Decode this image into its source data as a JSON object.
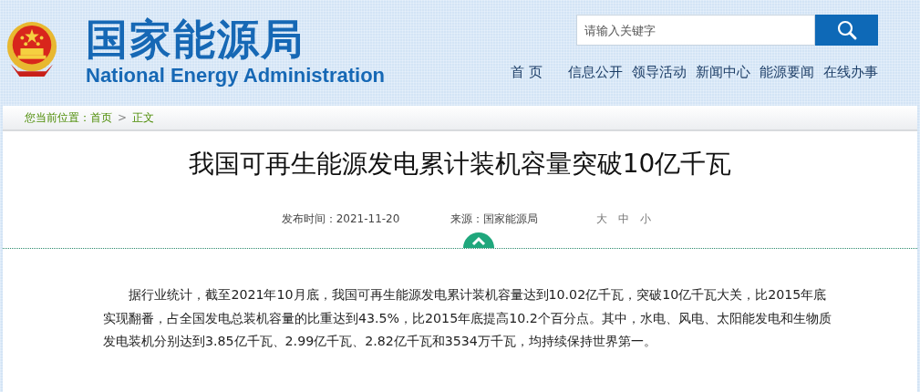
{
  "header": {
    "title": "国家能源局",
    "subtitle": "National Energy Administration"
  },
  "search": {
    "placeholder": "请输入关键字"
  },
  "nav": [
    {
      "label": "首 页",
      "selected": false
    },
    {
      "label": "信息公开",
      "selected": false
    },
    {
      "label": "领导活动",
      "selected": false
    },
    {
      "label": "新闻中心",
      "selected": false
    },
    {
      "label": "能源要闻",
      "selected": false
    },
    {
      "label": "在线办事",
      "selected": false
    }
  ],
  "breadcrumb": {
    "label": "您当前位置：",
    "items": [
      "首页",
      "正文"
    ],
    "separator": ">"
  },
  "article": {
    "title": "我国可再生能源发电累计装机容量突破10亿千瓦",
    "published": "发布时间：2021-11-20",
    "source": "来源：国家能源局",
    "font_sizes": [
      "大",
      "中",
      "小"
    ],
    "paragraphs": [
      "据行业统计，截至2021年10月底，我国可再生能源发电累计装机容量达到10.02亿千瓦，突破10亿千瓦大关，比2015年底实现翻番，占全国发电总装机容量的比重达到43.5%，比2015年底提高10.2个百分点。其中，水电、风电、太阳能发电和生物质发电装机分别达到3.85亿千瓦、2.99亿千瓦、2.82亿千瓦和3534万千瓦，均持续保持世界第一。"
    ]
  }
}
